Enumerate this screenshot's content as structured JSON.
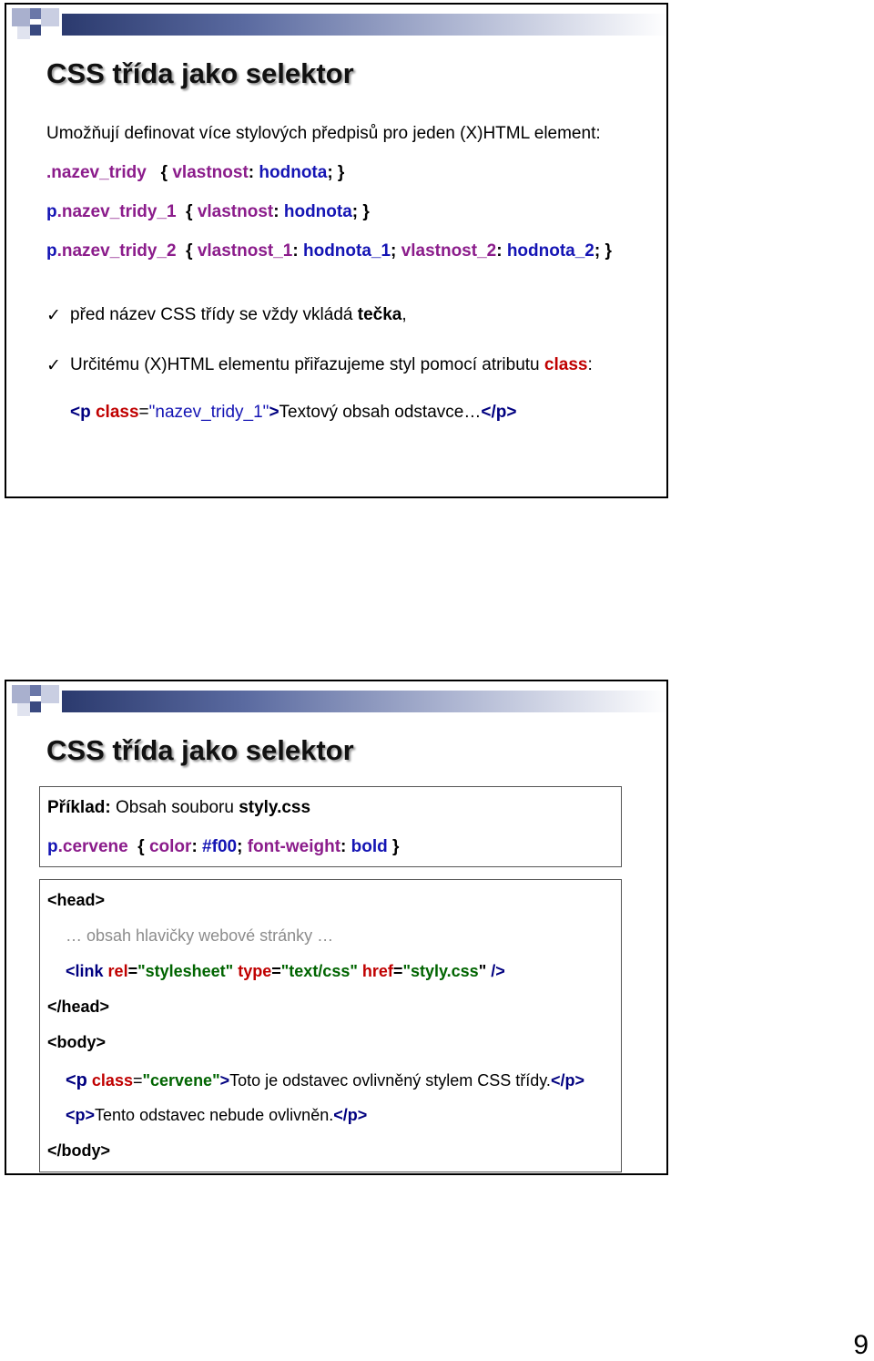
{
  "slide1": {
    "title": "CSS třída jako selektor",
    "intro": "Umožňují definovat více stylových předpisů pro jeden (X)HTML element:",
    "code1": {
      "selector": ".nazev_tridy",
      "open": "{",
      "prop": "vlastnost",
      "colon": ":",
      "value": "hodnota",
      "close": "; }"
    },
    "code2": {
      "selector_p": "p",
      "selector_cls": ".nazev_tridy_1",
      "open": "{",
      "prop": "vlastnost",
      "colon": ":",
      "value": "hodnota",
      "close": "; }"
    },
    "code3": {
      "selector_p": "p",
      "selector_cls": ".nazev_tridy_2",
      "open": "{",
      "prop1": "vlastnost_1",
      "colon1": ":",
      "value1": "hodnota_1",
      "sep": ";",
      "prop2": "vlastnost_2",
      "colon2": ":",
      "value2": "hodnota_2",
      "close": "; }"
    },
    "bullet1": {
      "check": "✓",
      "text_before": "před název CSS třídy se vždy vkládá ",
      "bold": "tečka",
      "text_after": ","
    },
    "bullet2": {
      "check": "✓",
      "text_before": "Určitému (X)HTML elementu přiřazujeme styl pomocí atributu ",
      "keyword": "class",
      "text_after": ":"
    },
    "example": {
      "tag_open": "<p",
      "attr": "class",
      "eq": "=",
      "value": "\"nazev_tridy_1\"",
      "tag_end": ">",
      "text": "Textový obsah odstavce…",
      "tag_close": "</p>"
    }
  },
  "slide2": {
    "title": "CSS třída jako selektor",
    "box1": {
      "label": "Příklad:",
      "text": " Obsah souboru ",
      "filename": "styly.css",
      "rule_p": "p",
      "rule_cls": ".cervene",
      "open": "{",
      "prop1": "color",
      "colon1": ":",
      "value1": "#f00",
      "sep": ";",
      "prop2": "font-weight",
      "colon2": ":",
      "value2": "bold",
      "close": "}"
    },
    "box2": {
      "head_open": "<head>",
      "comment": "… obsah hlavičky webové stránky …",
      "link_tag": "<link",
      "rel_attr": "rel",
      "rel_value": "\"stylesheet\"",
      "type_attr": "type",
      "type_value": "\"text/css\"",
      "href_attr": "href",
      "href_value_pre": "\"styly.css",
      "href_value_post": "\"",
      "link_end": "/>",
      "eq": "=",
      "head_close": "</head>",
      "body_open": "<body>",
      "p1_tag": "<p",
      "p1_attr": "class",
      "p1_value": "\"cervene\"",
      "p1_end": ">",
      "p1_text": "Toto je odstavec ovlivněný stylem CSS třídy.",
      "p1_close": "</p>",
      "p2_tag": "<p>",
      "p2_text": "Tento odstavec nebude ovlivněn.",
      "p2_close": "</p>",
      "body_close": "</body>"
    }
  },
  "page_number": "9",
  "colors": {
    "property": "#8b1c8b",
    "value": "#1414b4",
    "keyword": "#c00000",
    "tag": "#000080"
  }
}
